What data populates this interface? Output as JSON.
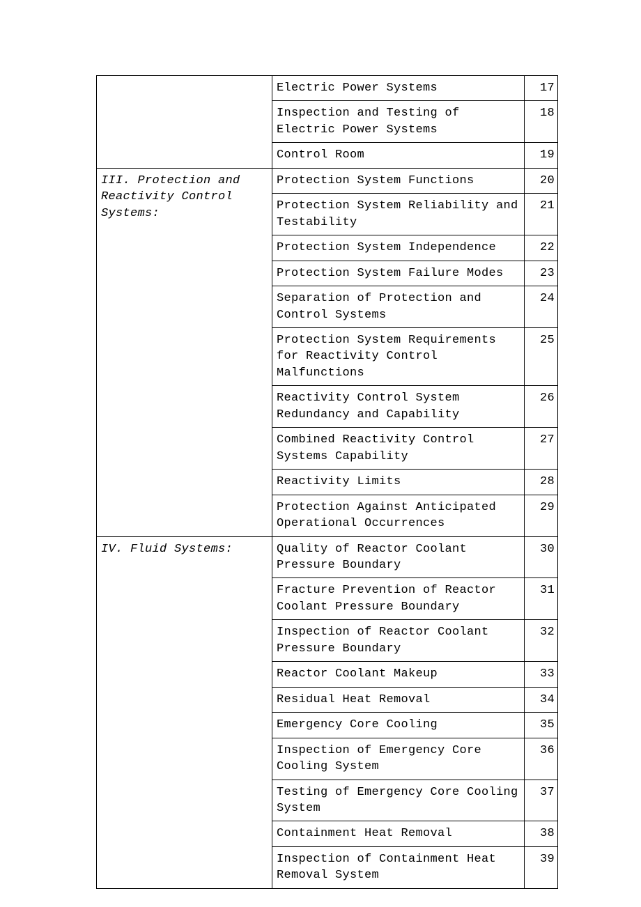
{
  "groups": [
    {
      "section": "",
      "rows": [
        {
          "item": "Electric Power Systems",
          "num": "17"
        },
        {
          "item": "Inspection and Testing of Electric Power Systems",
          "num": "18"
        },
        {
          "item": "Control Room",
          "num": "19"
        }
      ]
    },
    {
      "section": "III. Protection and Reactivity Control Systems:",
      "rows": [
        {
          "item": "Protection System Functions",
          "num": "20"
        },
        {
          "item": "Protection System Reliability and Testability",
          "num": "21"
        },
        {
          "item": "Protection System Independence",
          "num": "22"
        },
        {
          "item": "Protection System Failure Modes",
          "num": "23"
        },
        {
          "item": "Separation of Protection and Control Systems",
          "num": "24"
        },
        {
          "item": "Protection System Requirements for Reactivity Control Malfunctions",
          "num": "25"
        },
        {
          "item": "Reactivity Control System Redundancy and Capability",
          "num": "26"
        },
        {
          "item": "Combined Reactivity Control Systems Capability",
          "num": "27"
        },
        {
          "item": "Reactivity Limits",
          "num": "28"
        },
        {
          "item": "Protection Against Anticipated Operational Occurrences",
          "num": "29"
        }
      ]
    },
    {
      "section": "IV. Fluid Systems:",
      "rows": [
        {
          "item": "Quality of Reactor Coolant Pressure Boundary",
          "num": "30"
        },
        {
          "item": "Fracture Prevention of Reactor Coolant Pressure Boundary",
          "num": "31"
        },
        {
          "item": "Inspection of Reactor Coolant Pressure Boundary",
          "num": "32"
        },
        {
          "item": "Reactor Coolant Makeup",
          "num": "33"
        },
        {
          "item": "Residual Heat Removal",
          "num": "34"
        },
        {
          "item": "Emergency Core Cooling",
          "num": "35"
        },
        {
          "item": "Inspection of Emergency Core Cooling System",
          "num": "36"
        },
        {
          "item": "Testing of Emergency Core Cooling System",
          "num": "37"
        },
        {
          "item": "Containment Heat Removal",
          "num": "38"
        },
        {
          "item": "Inspection of Containment Heat Removal System",
          "num": "39"
        }
      ]
    }
  ]
}
